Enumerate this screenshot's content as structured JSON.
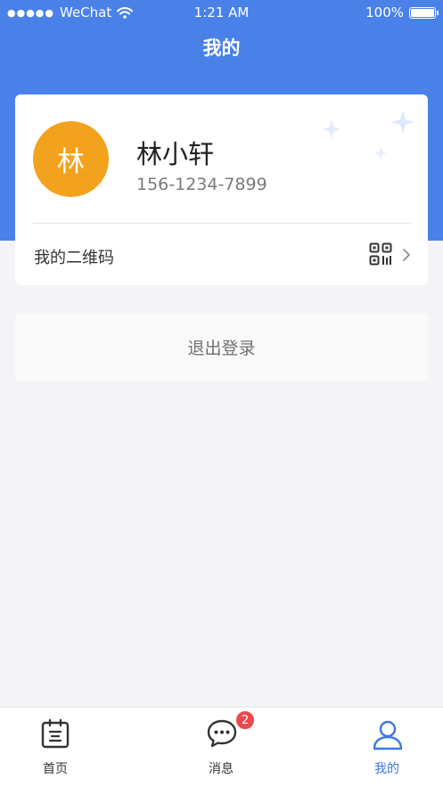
{
  "status_bar": {
    "signal_dots": "●●●●●",
    "carrier": "WeChat",
    "time": "1:21 AM",
    "battery_percent": "100%",
    "battery_level": 1.0
  },
  "header": {
    "title": "我的"
  },
  "profile": {
    "avatar_char": "林",
    "name": "林小轩",
    "phone": "156-1234-7899",
    "qrcode_label": "我的二维码"
  },
  "actions": {
    "logout_label": "退出登录"
  },
  "tab_bar": {
    "items": [
      {
        "label": "首页",
        "icon": "home-calendar-icon"
      },
      {
        "label": "消息",
        "icon": "message-icon",
        "badge": "2"
      },
      {
        "label": "我的",
        "icon": "user-icon",
        "active": true
      }
    ]
  },
  "colors": {
    "brand_blue": "#4a81e9",
    "avatar_bg": "#f2a21d",
    "badge_red": "#e9494f",
    "active_tab": "#3d78e4"
  }
}
